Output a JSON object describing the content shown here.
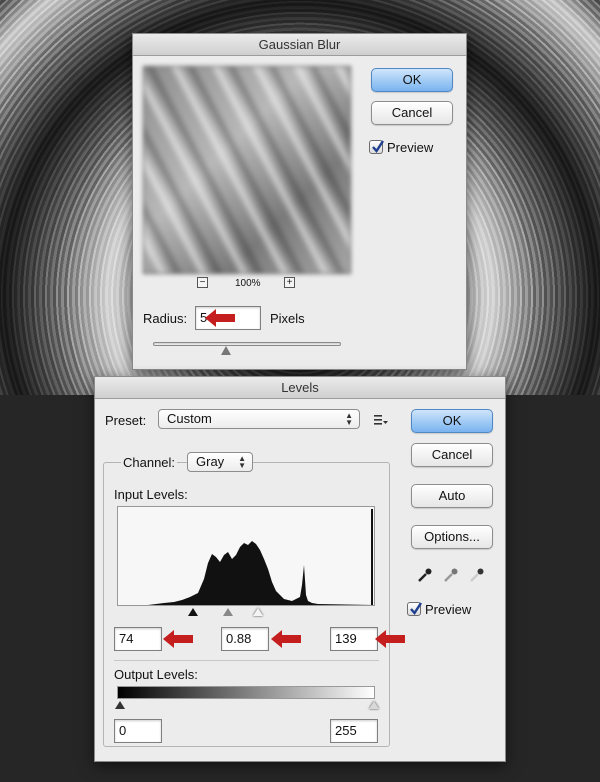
{
  "gaussian_blur": {
    "title": "Gaussian Blur",
    "ok_label": "OK",
    "cancel_label": "Cancel",
    "preview_label": "Preview",
    "preview_checked": true,
    "zoom_out_symbol": "−",
    "zoom_in_symbol": "+",
    "zoom_level": "100%",
    "radius_label": "Radius:",
    "radius_value": "5",
    "radius_unit": "Pixels",
    "radius_slider_fraction": 0.2
  },
  "levels": {
    "title": "Levels",
    "preset_label": "Preset:",
    "preset_value": "Custom",
    "channel_label": "Channel:",
    "channel_value": "Gray",
    "input_levels_label": "Input Levels:",
    "input_black": "74",
    "input_gamma": "0.88",
    "input_white": "139",
    "output_levels_label": "Output Levels:",
    "output_black": "0",
    "output_white": "255",
    "ok_label": "OK",
    "cancel_label": "Cancel",
    "auto_label": "Auto",
    "options_label": "Options...",
    "preview_label": "Preview",
    "preview_checked": true,
    "histogram_color": "#111111"
  },
  "annotations": {
    "arrow_color": "#c41e1e",
    "preset_menu_icon": "list-options-icon",
    "eyedropper_icons": [
      "black-eyedropper-icon",
      "gray-eyedropper-icon",
      "white-eyedropper-icon"
    ]
  }
}
